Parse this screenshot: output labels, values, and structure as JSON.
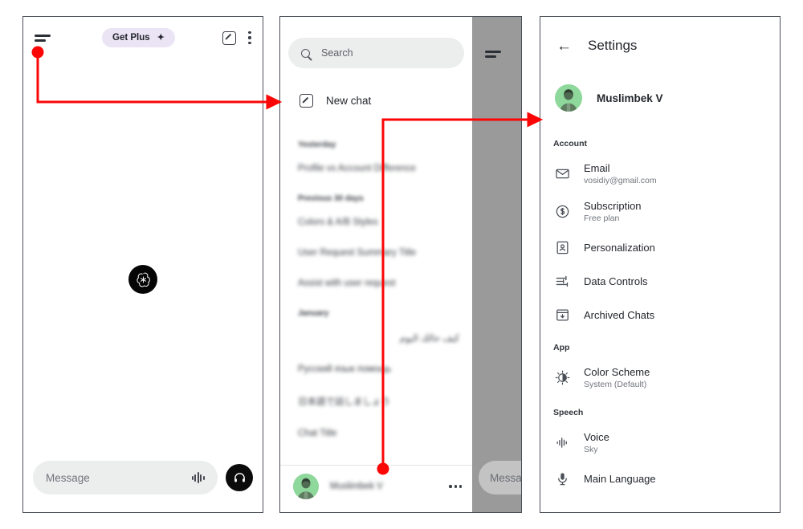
{
  "panel1": {
    "menu_icon": "hamburger-icon",
    "get_plus_label": "Get Plus",
    "get_plus_sparkle": "✦",
    "compose_icon": "compose-icon",
    "overflow_icon": "kebab-menu-icon",
    "brand_logo": "openai-logo",
    "composer": {
      "placeholder": "Message",
      "waveform_icon": "waveform-icon",
      "voice_icon": "headphones-icon"
    }
  },
  "panel2": {
    "search": {
      "placeholder": "Search",
      "icon": "search-icon"
    },
    "new_chat": {
      "label": "New chat",
      "icon": "compose-icon"
    },
    "groups": [
      {
        "label": "Yesterday",
        "items": [
          "Profile vs Account Difference"
        ]
      },
      {
        "label": "Previous 30 days",
        "items": [
          "Colors & A/B Styles",
          "User Request Summary Title",
          "Assist with user request"
        ]
      },
      {
        "label": "January",
        "items": [
          "كيف حالك اليوم",
          "Русский язык помощь",
          "日本語で話しましょう",
          "Chat Title"
        ]
      }
    ],
    "profile": {
      "name": "Muslimbek V",
      "overflow_icon": "kebab-menu-icon",
      "avatar": "user-avatar"
    },
    "scrim_menu_icon": "hamburger-icon",
    "scrim_composer_placeholder": "Message"
  },
  "panel3": {
    "back_icon": "back-arrow-icon",
    "title": "Settings",
    "profile": {
      "name": "Muslimbek V",
      "avatar": "user-avatar"
    },
    "sections": [
      {
        "label": "Account",
        "items": [
          {
            "icon": "mail-icon",
            "label": "Email",
            "sub": "vosidiy@gmail.com"
          },
          {
            "icon": "dollar-circle-icon",
            "label": "Subscription",
            "sub": "Free plan"
          },
          {
            "icon": "person-card-icon",
            "label": "Personalization",
            "sub": ""
          },
          {
            "icon": "sliders-icon",
            "label": "Data Controls",
            "sub": ""
          },
          {
            "icon": "archive-icon",
            "label": "Archived Chats",
            "sub": ""
          }
        ]
      },
      {
        "label": "App",
        "items": [
          {
            "icon": "contrast-icon",
            "label": "Color Scheme",
            "sub": "System (Default)"
          }
        ]
      },
      {
        "label": "Speech",
        "items": [
          {
            "icon": "waveform-icon",
            "label": "Voice",
            "sub": "Sky"
          },
          {
            "icon": "microphone-icon",
            "label": "Main Language",
            "sub": ""
          }
        ]
      }
    ]
  },
  "annotations": {
    "color": "#fb0606",
    "arrows": [
      {
        "name": "arrow-menu-to-drawer",
        "from": "hamburger-icon-panel1",
        "to": "drawer-panel2"
      },
      {
        "name": "arrow-profile-to-settings",
        "from": "profile-row-panel2",
        "to": "settings-panel3"
      }
    ]
  }
}
